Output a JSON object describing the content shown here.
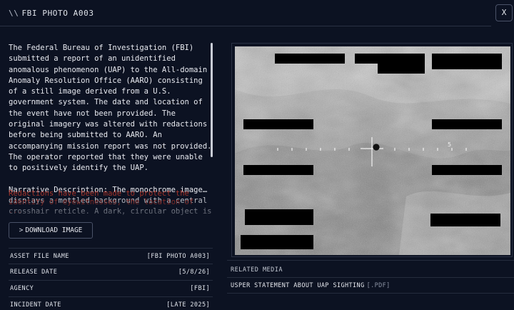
{
  "header": {
    "prefix": "\\\\",
    "title": "FBI PHOTO A003",
    "close_label": "X"
  },
  "summary": "The Federal Bureau of Investigation (FBI) submitted a report of an unidentified anomalous phenomenon (UAP) to the All-domain Anomaly Resolution Office (AARO) consisting of a still image derived from a U.S. government system. The date and location of the event have not been provided. The original imagery was altered with redactions before being submitted to AARO. An accompanying mission report was not provided. The operator reported that they were unable to positively identify the UAP.",
  "narrative": "Narrative Description: The monochrome image… displays a mottled background with a central crosshair reticle. A dark, circular object is positioned exactly at the center of the reticle. The background shows a textured pattern, ...",
  "redaction_note": "Redactions have been made to protect the identity of eyewitnesses, the location of ...",
  "download_label": "DOWNLOAD IMAGE",
  "download_chevron": ">",
  "metadata": [
    {
      "label": "ASSET FILE NAME",
      "value": "[FBI PHOTO A003]"
    },
    {
      "label": "RELEASE DATE",
      "value": "[5/8/26]"
    },
    {
      "label": "AGENCY",
      "value": "[FBI]"
    },
    {
      "label": "INCIDENT DATE",
      "value": "[LATE 2025]"
    }
  ],
  "image": {
    "reticle_mark": "5"
  },
  "related": {
    "heading": "RELATED MEDIA",
    "item_label": "USPER STATEMENT ABOUT UAP SIGHTING",
    "item_ext": "[.PDF]"
  },
  "colors": {
    "background": "#0c1222",
    "border": "#2a3144",
    "redaction_text": "#c0392b"
  },
  "icons": {
    "close": "close-icon",
    "download": "chevron-right-icon"
  }
}
